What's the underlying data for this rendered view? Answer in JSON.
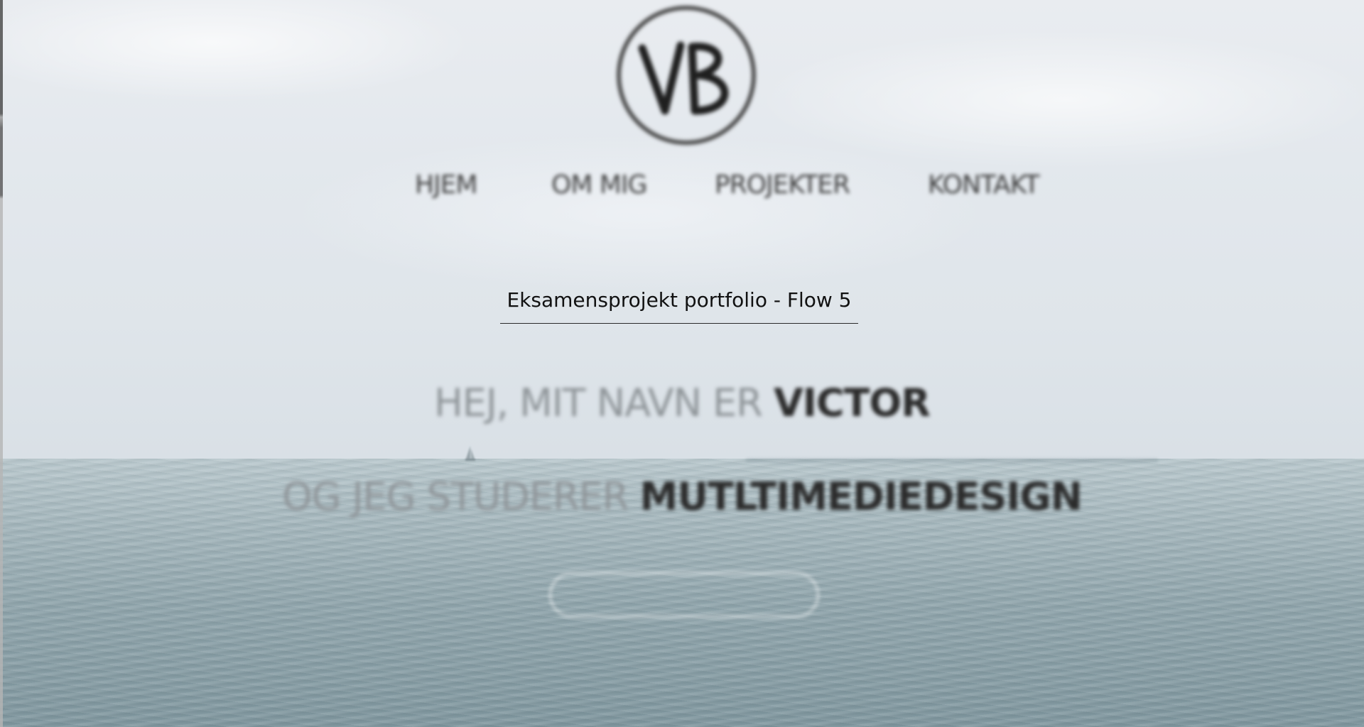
{
  "brand": {
    "logo_initials": "VB"
  },
  "nav": {
    "items": [
      {
        "label": "HJEM"
      },
      {
        "label": "OM MIG"
      },
      {
        "label": "PROJEKTER"
      },
      {
        "label": "KONTAKT"
      }
    ]
  },
  "overlay": {
    "title": "Eksamensprojekt portfolio - Flow 5"
  },
  "hero": {
    "line1_light": "HEJ, MIT NAVN ER ",
    "line1_bold": "VICTOR",
    "line2_light": "OG JEG STUDERER ",
    "line2_bold": "MUTLTIMEDIEDESIGN"
  },
  "colors": {
    "nav_text": "#3d3d3d",
    "hero_light": "#8e9498",
    "hero_bold": "#2b2b2b",
    "sky": "#e3e8ed",
    "sea": "#8fa4ab"
  }
}
